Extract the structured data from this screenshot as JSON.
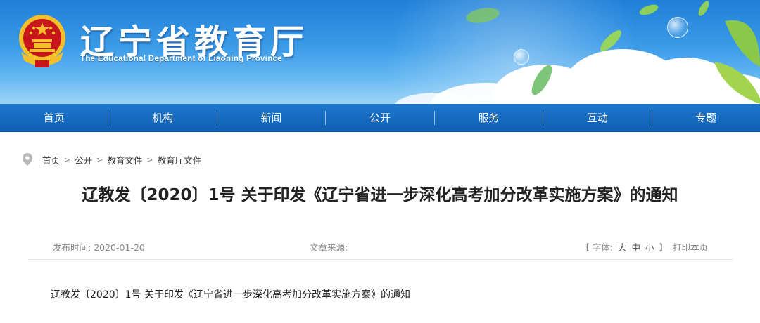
{
  "header": {
    "site_title": "辽宁省教育厅",
    "site_subtitle": "The Educational Department of Liaoning Province"
  },
  "nav": {
    "items": [
      "首页",
      "机构",
      "新闻",
      "公开",
      "服务",
      "互动",
      "专题"
    ]
  },
  "breadcrumb": {
    "items": [
      "首页",
      "公开",
      "教育文件",
      "教育厅文件"
    ],
    "separator": ">"
  },
  "article": {
    "title": "辽教发〔2020〕1号 关于印发《辽宁省进一步深化高考加分改革实施方案》的通知",
    "publish_label": "发布时间:",
    "publish_date": "2020-01-20",
    "source_label": "文章来源:",
    "source_value": "",
    "font_label": "【 字体:",
    "font_large": "大",
    "font_medium": "中",
    "font_small": "小",
    "font_close": "】",
    "print_label": "打印本页",
    "body_first_line": "辽教发〔2020〕1号 关于印发《辽宁省进一步深化高考加分改革实施方案》的通知"
  },
  "colors": {
    "nav_bg": "#1468c0",
    "banner_sky": "#3a9be8",
    "emblem_red": "#c8161d",
    "emblem_gold": "#f3c02a"
  }
}
